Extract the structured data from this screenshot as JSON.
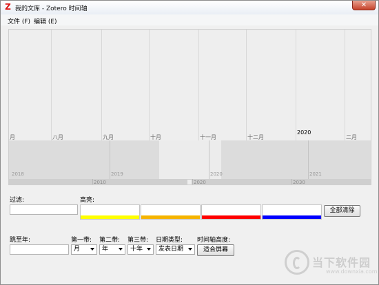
{
  "window": {
    "title": "我的文库 - Zotero 时间轴",
    "app_icon": "Z",
    "close_label": "✕"
  },
  "menu": [
    {
      "label": "文件 (F)"
    },
    {
      "label": "编辑 (E)"
    }
  ],
  "timeline": {
    "months": [
      "月",
      "八月",
      "九月",
      "十月",
      "十一月",
      "十二月",
      "2020",
      "二月"
    ],
    "years": [
      "2018",
      "2019",
      "2020",
      "2021"
    ],
    "decades": [
      "2010",
      "2020",
      "2030"
    ]
  },
  "filter": {
    "label": "过滤:",
    "value": ""
  },
  "highlight": {
    "label": "高亮:",
    "colors": [
      "#ffff00",
      "#f5b400",
      "#ff0000",
      "#0000ff"
    ],
    "clear_all_label": "全部清除"
  },
  "jump": {
    "label": "跳至年:",
    "value": ""
  },
  "bands": {
    "band1_label": "第一带:",
    "band2_label": "第二带:",
    "band3_label": "第三带:",
    "band1_value": "月",
    "band2_value": "年",
    "band3_value": "十年"
  },
  "date_type": {
    "label": "日期类型:",
    "value": "发表日期"
  },
  "height": {
    "label": "时间轴高度:",
    "fit_label": "适合屏幕"
  },
  "watermark": {
    "name": "当下软件园",
    "url": "www.downxia.com",
    "icon": "downxia-logo-icon"
  }
}
